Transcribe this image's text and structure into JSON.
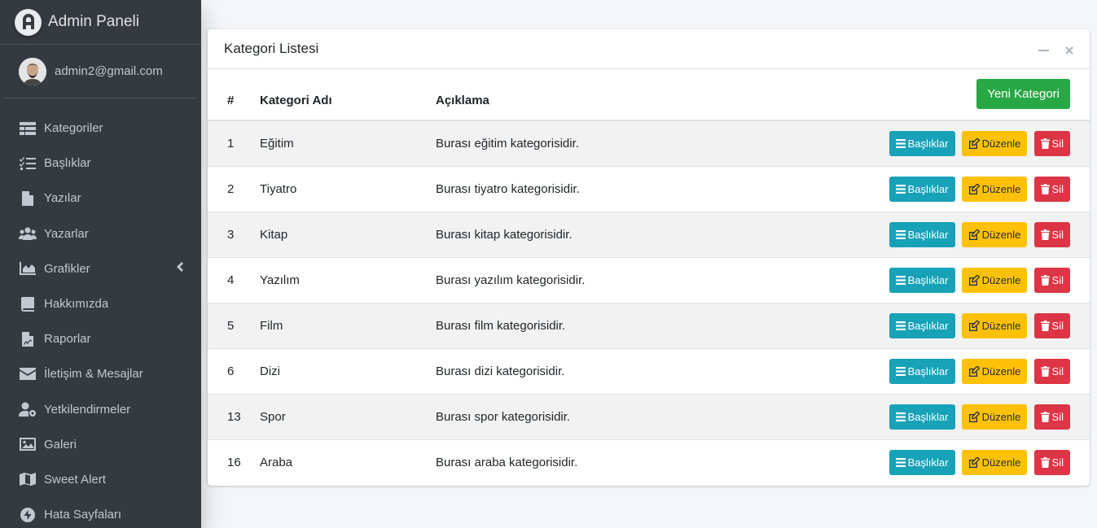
{
  "brand": {
    "title": "Admin Paneli"
  },
  "user": {
    "email": "admin2@gmail.com"
  },
  "nav": [
    {
      "label": "Kategoriler",
      "icon": "table-icon"
    },
    {
      "label": "Başlıklar",
      "icon": "tasks-icon"
    },
    {
      "label": "Yazılar",
      "icon": "file-icon"
    },
    {
      "label": "Yazarlar",
      "icon": "users-icon"
    },
    {
      "label": "Grafikler",
      "icon": "area-chart-icon"
    },
    {
      "label": "Hakkımızda",
      "icon": "book-icon"
    },
    {
      "label": "Raporlar",
      "icon": "file-chart-icon"
    },
    {
      "label": "İletişim & Mesajlar",
      "icon": "envelope-icon"
    },
    {
      "label": "Yetkilendirmeler",
      "icon": "user-cog-icon"
    },
    {
      "label": "Galeri",
      "icon": "image-icon"
    },
    {
      "label": "Sweet Alert",
      "icon": "map-icon"
    },
    {
      "label": "Hata Sayfaları",
      "icon": "error-pages-icon"
    }
  ],
  "card": {
    "title": "Kategori Listesi",
    "new_button": "Yeni Kategori",
    "columns": {
      "num": "#",
      "name": "Kategori Adı",
      "desc": "Açıklama"
    },
    "actions": {
      "titles": "Başlıklar",
      "edit": "Düzenle",
      "delete": "Sil"
    },
    "rows": [
      {
        "id": "1",
        "name": "Eğitim",
        "desc": "Burası eğitim kategorisidir."
      },
      {
        "id": "2",
        "name": "Tiyatro",
        "desc": "Burası tiyatro kategorisidir."
      },
      {
        "id": "3",
        "name": "Kitap",
        "desc": "Burası kitap kategorisidir."
      },
      {
        "id": "4",
        "name": "Yazılım",
        "desc": "Burası yazılım kategorisidir."
      },
      {
        "id": "5",
        "name": "Film",
        "desc": "Burası film kategorisidir."
      },
      {
        "id": "6",
        "name": "Dizi",
        "desc": "Burası dizi kategorisidir."
      },
      {
        "id": "13",
        "name": "Spor",
        "desc": "Burası spor kategorisidir."
      },
      {
        "id": "16",
        "name": "Araba",
        "desc": "Burası araba kategorisidir."
      }
    ]
  },
  "colors": {
    "sidebar": "#343a40",
    "success": "#28a745",
    "info": "#17a2b8",
    "warning": "#ffc107",
    "danger": "#dc3545"
  }
}
